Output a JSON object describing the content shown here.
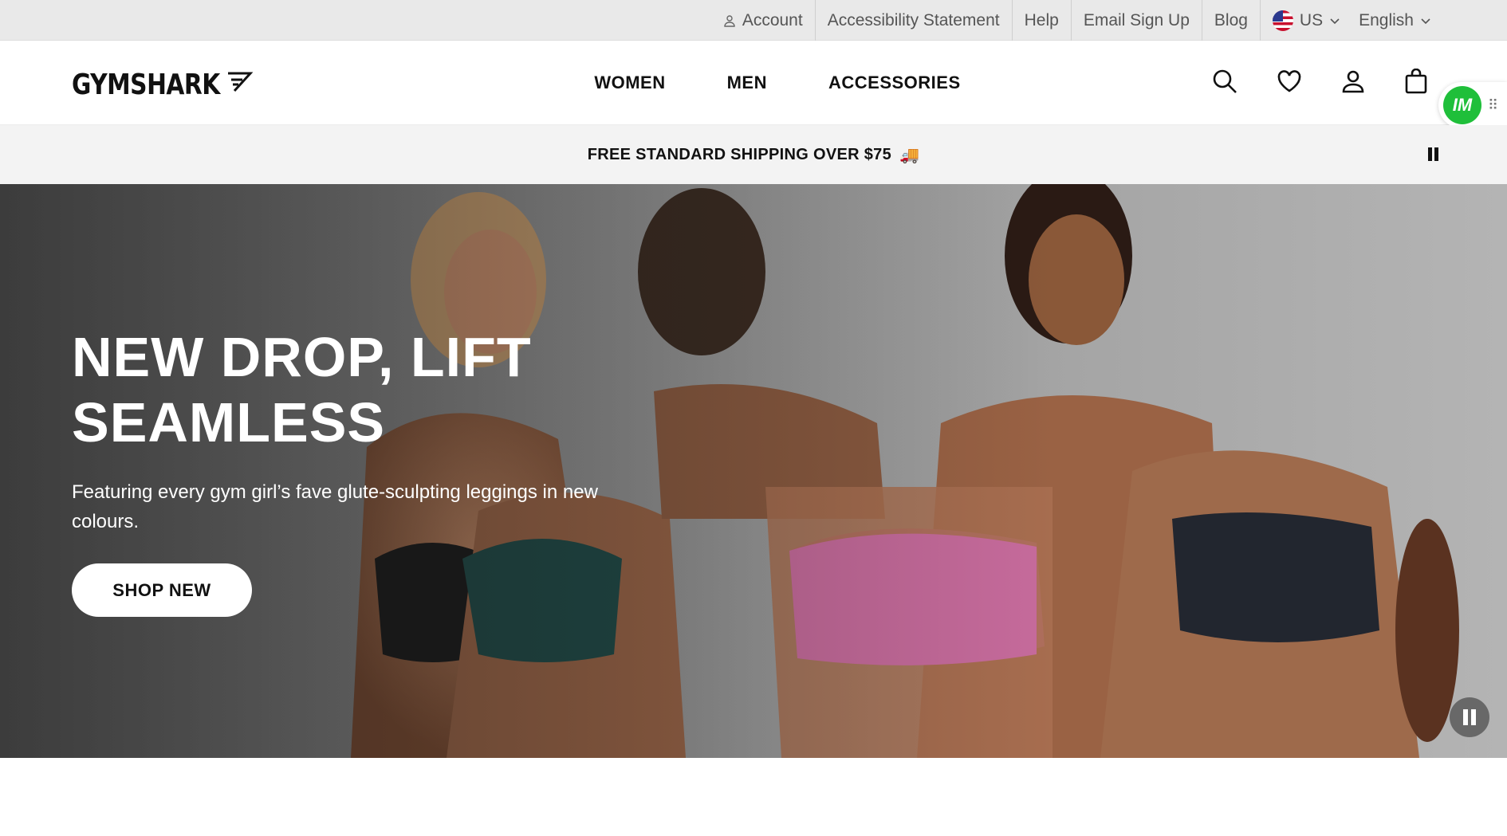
{
  "utility_bar": {
    "items": [
      {
        "label": "Account",
        "icon": "user-icon"
      },
      {
        "label": "Accessibility Statement"
      },
      {
        "label": "Help"
      },
      {
        "label": "Email Sign Up"
      },
      {
        "label": "Blog"
      }
    ],
    "country": {
      "label": "US",
      "icon": "us-flag-icon"
    },
    "language": {
      "label": "English"
    }
  },
  "header": {
    "logo_text": "GYMSHARK",
    "nav": [
      "WOMEN",
      "MEN",
      "ACCESSORIES"
    ],
    "icons": [
      "search-icon",
      "heart-icon",
      "user-icon",
      "bag-icon"
    ],
    "widget_label": "IM"
  },
  "promo": {
    "text": "FREE STANDARD SHIPPING OVER $75",
    "emoji": "🚚"
  },
  "hero": {
    "title": "NEW DROP, LIFT SEAMLESS",
    "subtitle": "Featuring every gym girl’s fave glute-sculpting leggings in new colours.",
    "cta_label": "SHOP NEW"
  },
  "colors": {
    "utility_bg": "#e9e9e9",
    "promo_bg": "#f3f3f3",
    "widget_green": "#1fbf3a",
    "text": "#111111"
  }
}
